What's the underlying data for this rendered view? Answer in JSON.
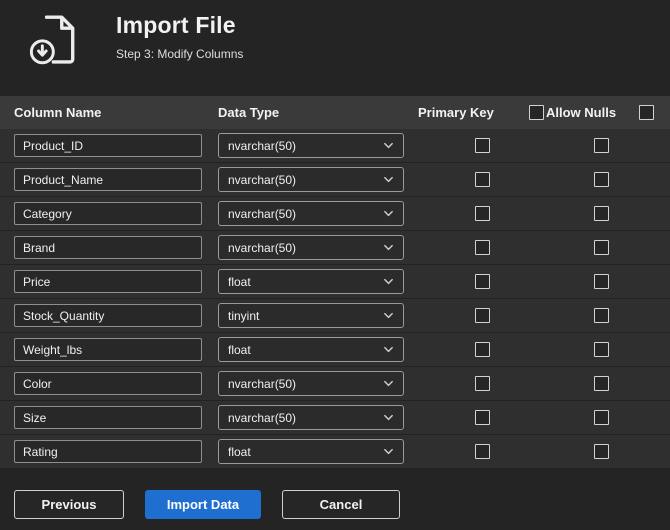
{
  "header": {
    "title": "Import File",
    "subtitle": "Step 3: Modify Columns",
    "icon": "import-file-icon"
  },
  "table": {
    "columns": {
      "name": "Column Name",
      "type": "Data Type",
      "primary_key": "Primary Key",
      "allow_nulls": "Allow Nulls"
    },
    "header_checkboxes": {
      "primary_key_all": false,
      "allow_nulls_all": false
    },
    "rows": [
      {
        "name": "Product_ID",
        "type": "nvarchar(50)",
        "primary_key": false,
        "allow_nulls": false
      },
      {
        "name": "Product_Name",
        "type": "nvarchar(50)",
        "primary_key": false,
        "allow_nulls": false
      },
      {
        "name": "Category",
        "type": "nvarchar(50)",
        "primary_key": false,
        "allow_nulls": false
      },
      {
        "name": "Brand",
        "type": "nvarchar(50)",
        "primary_key": false,
        "allow_nulls": false
      },
      {
        "name": "Price",
        "type": "float",
        "primary_key": false,
        "allow_nulls": false
      },
      {
        "name": "Stock_Quantity",
        "type": "tinyint",
        "primary_key": false,
        "allow_nulls": false
      },
      {
        "name": "Weight_lbs",
        "type": "float",
        "primary_key": false,
        "allow_nulls": false
      },
      {
        "name": "Color",
        "type": "nvarchar(50)",
        "primary_key": false,
        "allow_nulls": false
      },
      {
        "name": "Size",
        "type": "nvarchar(50)",
        "primary_key": false,
        "allow_nulls": false
      },
      {
        "name": "Rating",
        "type": "float",
        "primary_key": false,
        "allow_nulls": false
      }
    ]
  },
  "buttons": {
    "previous": "Previous",
    "import": "Import Data",
    "cancel": "Cancel"
  },
  "colors": {
    "accent": "#1f6fd0",
    "background": "#242424",
    "table_header": "#3a3a3a",
    "row": "#2f2f2f"
  }
}
